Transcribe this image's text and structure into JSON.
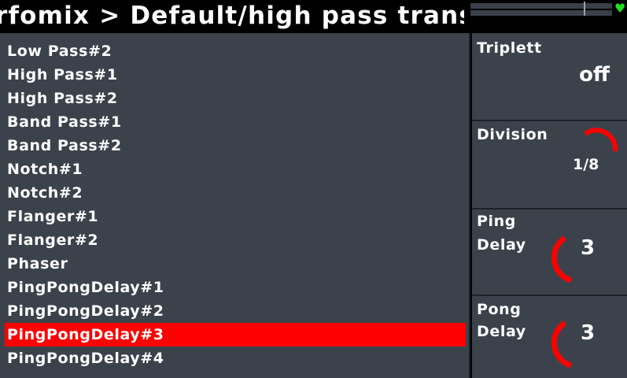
{
  "header": {
    "title": "rfomix > Default/high pass trans"
  },
  "status": {
    "heart_icon": "heart-icon",
    "heart_color": "#22dd22"
  },
  "effects_list": {
    "items": [
      "Low Pass#2",
      "High Pass#1",
      "High Pass#2",
      "Band Pass#1",
      "Band Pass#2",
      "Notch#1",
      "Notch#2",
      "Flanger#1",
      "Flanger#2",
      "Phaser",
      "PingPongDelay#1",
      "PingPongDelay#2",
      "PingPongDelay#3",
      "PingPongDelay#4"
    ],
    "selected_index": 12,
    "selected_color": "#ff0000"
  },
  "params": {
    "triplett": {
      "label": "Triplett",
      "value": "off"
    },
    "division": {
      "label": "Division",
      "value": "1/8"
    },
    "ping_delay": {
      "label_line1": "Ping",
      "label_line2": "Delay",
      "value": "3"
    },
    "pong_delay": {
      "label_line1": "Pong",
      "label_line2": "Delay",
      "value": "3"
    }
  },
  "colors": {
    "background": "#3c424c",
    "accent": "#ff0000"
  }
}
